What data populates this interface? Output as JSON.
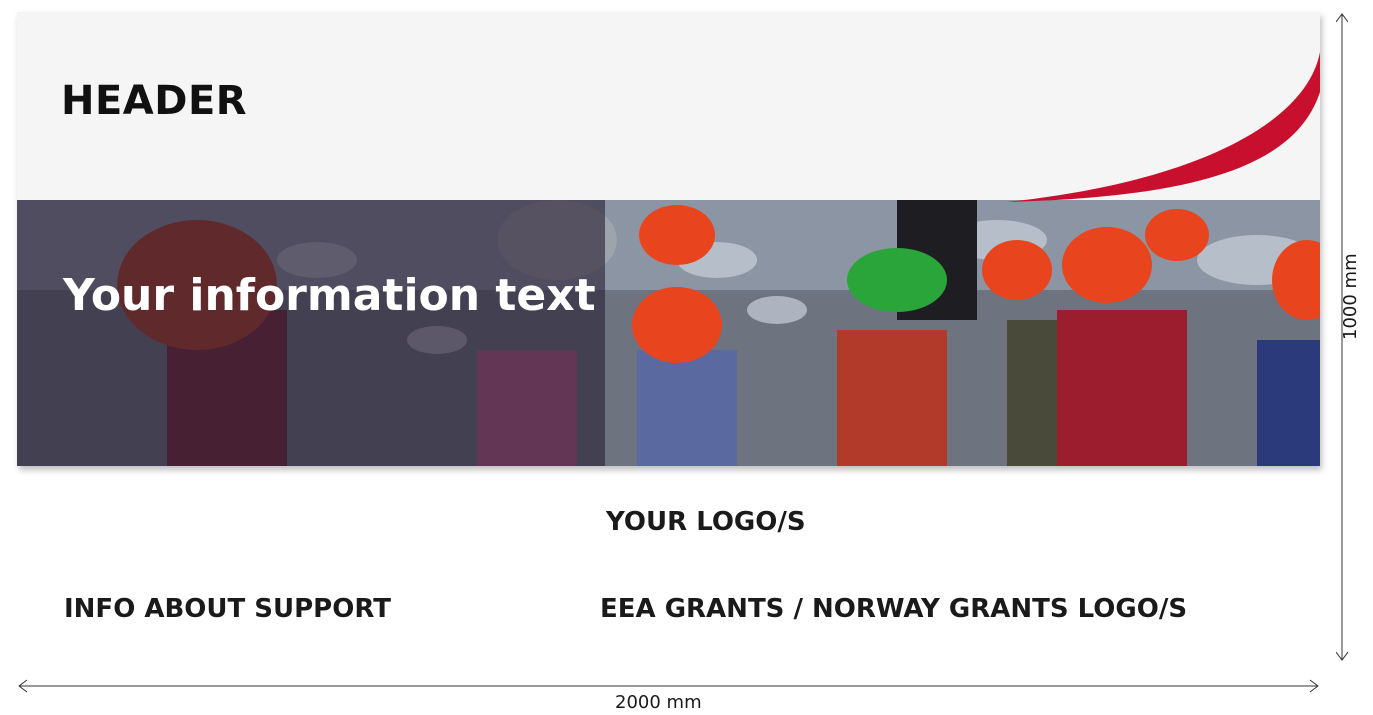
{
  "banner": {
    "header": "HEADER",
    "info_text": "Your information text"
  },
  "labels": {
    "your_logos": "YOUR LOGO/S",
    "info_about_support": "INFO ABOUT SUPPORT",
    "grants_logos": "EEA GRANTS / NORWAY GRANTS LOGO/S"
  },
  "dimensions": {
    "height": "1000 mm",
    "width": "2000 mm"
  },
  "colors": {
    "swoosh": "#c8102e",
    "helmet_orange": "#e8451e",
    "helmet_green": "#2aa53a"
  }
}
